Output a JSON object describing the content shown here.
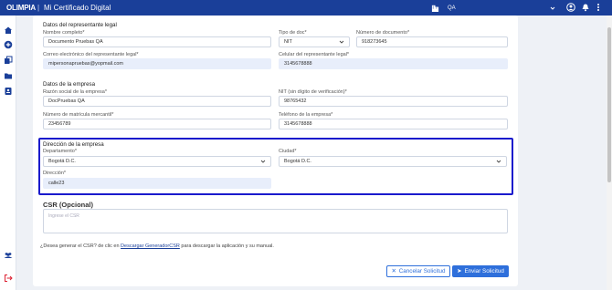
{
  "topbar": {
    "logo": "OLIMPIA",
    "separator": "|",
    "app_title": "Mi Certificado Digital",
    "environment": "QA"
  },
  "form": {
    "legal_rep": {
      "title": "Datos del representante legal",
      "full_name_label": "Nombre completo*",
      "full_name_value": "Documento Pruebas QA",
      "doc_type_label": "Tipo de doc*",
      "doc_type_value": "NIT",
      "doc_number_label": "Número de documento*",
      "doc_number_value": "918273645",
      "email_label": "Correo electrónico del representante legal*",
      "email_value": "mipersonapruebas@yopmail.com",
      "phone_label": "Celular del representante legal*",
      "phone_value": "3145678888"
    },
    "company": {
      "title": "Datos de la empresa",
      "name_label": "Razón social de la empresa*",
      "name_value": "DocPruebas QA",
      "nit_label": "NIT (sin dígito de verificación)*",
      "nit_value": "98765432",
      "registration_label": "Número de matrícula mercantil*",
      "registration_value": "23456789",
      "phone_label": "Teléfono de la empresa*",
      "phone_value": "3145678888"
    },
    "address": {
      "title": "Dirección de la empresa",
      "department_label": "Departamento*",
      "department_value": "Bogotá D.C.",
      "city_label": "Ciudad*",
      "city_value": "Bogotá D.C.",
      "address_label": "Dirección*",
      "address_value": "calle23"
    },
    "csr": {
      "title": "CSR (Opcional)",
      "placeholder": "Ingrese el CSR",
      "info_prefix": "¿Desea generar el CSR? de clic en ",
      "info_link": "Descargar GeneradorCSR",
      "info_suffix": " para descargar la aplicación y su manual."
    },
    "buttons": {
      "cancel_label": "Cancelar Solicitud",
      "cancel_icon": "✕",
      "send_label": "Enviar Solicitud",
      "send_icon": "➤"
    }
  },
  "colors": {
    "brand": "#1a3f99",
    "accent": "#2e6fdb",
    "highlight_border": "#1a1acc",
    "filled_input": "#e8eefb"
  }
}
